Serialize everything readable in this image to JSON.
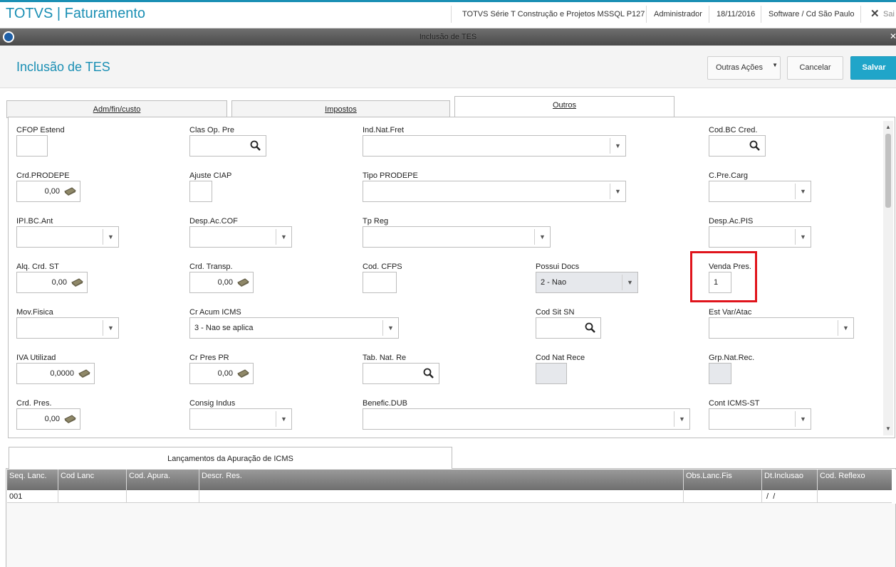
{
  "app": {
    "title": "TOTVS | Faturamento",
    "system": "TOTVS Série T Construção e Projetos MSSQL P127",
    "user": "Administrador",
    "date": "18/11/2016",
    "branch": "Software / Cd São Paulo",
    "exit_label": "Sai",
    "accent_color": "#1a8fb4"
  },
  "window": {
    "title": "Inclusão de TES"
  },
  "header": {
    "page_title": "Inclusão de TES",
    "btn_outras": "Outras Ações",
    "btn_cancelar": "Cancelar",
    "btn_salvar": "Salvar"
  },
  "tabs": [
    {
      "label": "Adm/fin/custo"
    },
    {
      "label": "Impostos"
    },
    {
      "label": "Outros"
    }
  ],
  "form": {
    "cfop_estend": {
      "label": "CFOP Estend",
      "value": ""
    },
    "clas_op_pre": {
      "label": "Clas Op. Pre",
      "value": ""
    },
    "ind_nat_fret": {
      "label": "Ind.Nat.Fret",
      "value": ""
    },
    "cod_bc_cred": {
      "label": "Cod.BC Cred.",
      "value": ""
    },
    "crd_prodepe": {
      "label": "Crd.PRODEPE",
      "value": "0,00"
    },
    "ajuste_ciap": {
      "label": "Ajuste CIAP",
      "value": ""
    },
    "tipo_prodepe": {
      "label": "Tipo PRODEPE",
      "value": ""
    },
    "c_pre_carg": {
      "label": "C.Pre.Carg",
      "value": ""
    },
    "ipi_bc_ant": {
      "label": "IPI.BC.Ant",
      "value": ""
    },
    "desp_ac_cof": {
      "label": "Desp.Ac.COF",
      "value": ""
    },
    "tp_reg": {
      "label": "Tp Reg",
      "value": ""
    },
    "desp_ac_pis": {
      "label": "Desp.Ac.PIS",
      "value": ""
    },
    "alq_crd_st": {
      "label": "Alq. Crd. ST",
      "value": "0,00"
    },
    "crd_transp": {
      "label": "Crd. Transp.",
      "value": "0,00"
    },
    "cod_cfps": {
      "label": "Cod. CFPS",
      "value": ""
    },
    "possui_docs": {
      "label": "Possui Docs",
      "value": "2 - Nao"
    },
    "venda_pres": {
      "label": "Venda Pres.",
      "value": "1"
    },
    "mov_fisica": {
      "label": "Mov.Fisica",
      "value": ""
    },
    "cr_acum_icms": {
      "label": "Cr Acum ICMS",
      "value": "3 - Nao se aplica"
    },
    "cod_sit_sn": {
      "label": "Cod Sit SN",
      "value": ""
    },
    "est_var_atac": {
      "label": "Est Var/Atac",
      "value": ""
    },
    "iva_utilizad": {
      "label": "IVA Utilizad",
      "value": "0,0000"
    },
    "cr_pres_pr": {
      "label": "Cr Pres PR",
      "value": "0,00"
    },
    "tab_nat_re": {
      "label": "Tab. Nat. Re",
      "value": ""
    },
    "cod_nat_rece": {
      "label": "Cod Nat Rece",
      "value": ""
    },
    "grp_nat_rec": {
      "label": "Grp.Nat.Rec.",
      "value": ""
    },
    "crd_pres": {
      "label": "Crd. Pres.",
      "value": "0,00"
    },
    "consig_indus": {
      "label": "Consig Indus",
      "value": ""
    },
    "benefic_dub": {
      "label": "Benefic.DUB",
      "value": ""
    },
    "cont_icms_st": {
      "label": "Cont ICMS-ST",
      "value": ""
    }
  },
  "grid": {
    "tab_label": "Lançamentos da Apuração de ICMS",
    "columns": [
      "Seq. Lanc.",
      "Cod Lanc",
      "Cod. Apura.",
      "Descr. Res.",
      "Obs.Lanc.Fis",
      "Dt.Inclusao",
      "Cod. Reflexo"
    ],
    "rows": [
      [
        "001",
        "",
        "",
        "",
        "",
        " /  /",
        ""
      ]
    ]
  }
}
